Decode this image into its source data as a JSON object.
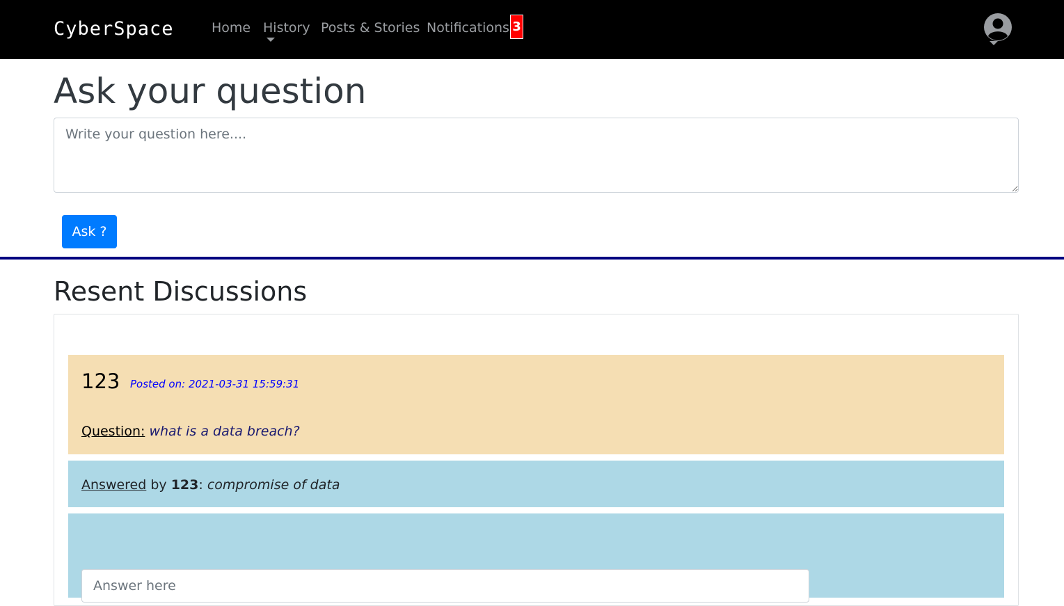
{
  "navbar": {
    "brand": "CyberSpace",
    "items": [
      {
        "label": "Home"
      },
      {
        "label": "History"
      },
      {
        "label": "Posts & Stories"
      },
      {
        "label": "Notifications"
      }
    ],
    "notification_count": "3",
    "profile_icon": "user-circle-icon"
  },
  "ask": {
    "title": "Ask your question",
    "placeholder": "Write your question here....",
    "button_label": "Ask ?"
  },
  "discussions": {
    "title": "Resent Discussions",
    "items": [
      {
        "user": "123",
        "posted_on": "Posted on: 2021-03-31 15:59:31",
        "question_label": "Question:",
        "question_text": "what is a data breach?",
        "answer": {
          "label": "Answered",
          "by_text": " by ",
          "user": "123",
          "colon": ": ",
          "text": "compromise of data"
        },
        "reply_placeholder": "Answer here"
      }
    ]
  },
  "colors": {
    "navbar_bg": "#000000",
    "badge_bg": "#ff0000",
    "primary_button": "#007bff",
    "divider": "#000080",
    "question_bg": "#f5deb3",
    "answer_bg": "#add8e6",
    "date_text": "#0000ff"
  }
}
